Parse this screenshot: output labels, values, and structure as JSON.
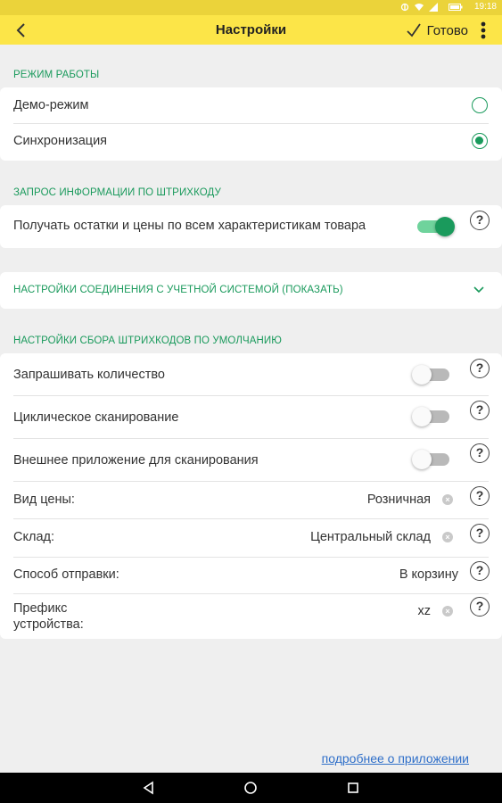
{
  "status_bar": {
    "time": "19:18",
    "icons": [
      "sync-icon",
      "wifi-icon",
      "signal-icon",
      "battery-icon"
    ]
  },
  "app_bar": {
    "back_icon": "chevron-left-icon",
    "title": "Настройки",
    "done_label": "Готово",
    "done_icon": "check-icon",
    "menu_icon": "more-vert-icon"
  },
  "work_mode": {
    "header": "РЕЖИМ РАБОТЫ",
    "options": [
      {
        "label": "Демо-режим",
        "selected": false
      },
      {
        "label": "Синхронизация",
        "selected": true
      }
    ]
  },
  "barcode_info": {
    "header": "ЗАПРОС ИНФОРМАЦИИ ПО ШТРИХКОДУ",
    "setting_label": "Получать остатки и цены по всем характеристикам товара",
    "enabled": true,
    "help": "?"
  },
  "connection": {
    "label": "НАСТРОЙКИ СОЕДИНЕНИЯ С УЧЕТНОЙ СИСТЕМОЙ (ПОКАЗАТЬ)",
    "icon": "chevron-down-icon"
  },
  "barcode_defaults": {
    "header": "НАСТРОЙКИ СБОРА ШТРИХКОДОВ ПО УМОЛЧАНИЮ",
    "toggles": [
      {
        "label": "Запрашивать количество",
        "enabled": false
      },
      {
        "label": "Циклическое сканирование",
        "enabled": false
      },
      {
        "label": "Внешнее приложение для сканирования",
        "enabled": false
      }
    ],
    "fields": [
      {
        "label": "Вид цены:",
        "value": "Розничная",
        "clearable": true
      },
      {
        "label": "Склад:",
        "value": "Центральный склад",
        "clearable": true
      },
      {
        "label": "Способ отправки:",
        "value": "В корзину",
        "clearable": false
      },
      {
        "label_line1": "Префикс",
        "label_line2": "устройства:",
        "value": "xz",
        "clearable": true
      }
    ],
    "help": "?"
  },
  "footer": {
    "more_link": "подробнее о приложении"
  },
  "nav_bar": {
    "back_icon": "nav-back-icon",
    "home_icon": "nav-home-icon",
    "recents_icon": "nav-recents-icon"
  },
  "colors": {
    "accent": "#1a9a5c",
    "app_bar": "#fce548",
    "status_bar": "#ebd33a",
    "link": "#2f6fc9"
  }
}
